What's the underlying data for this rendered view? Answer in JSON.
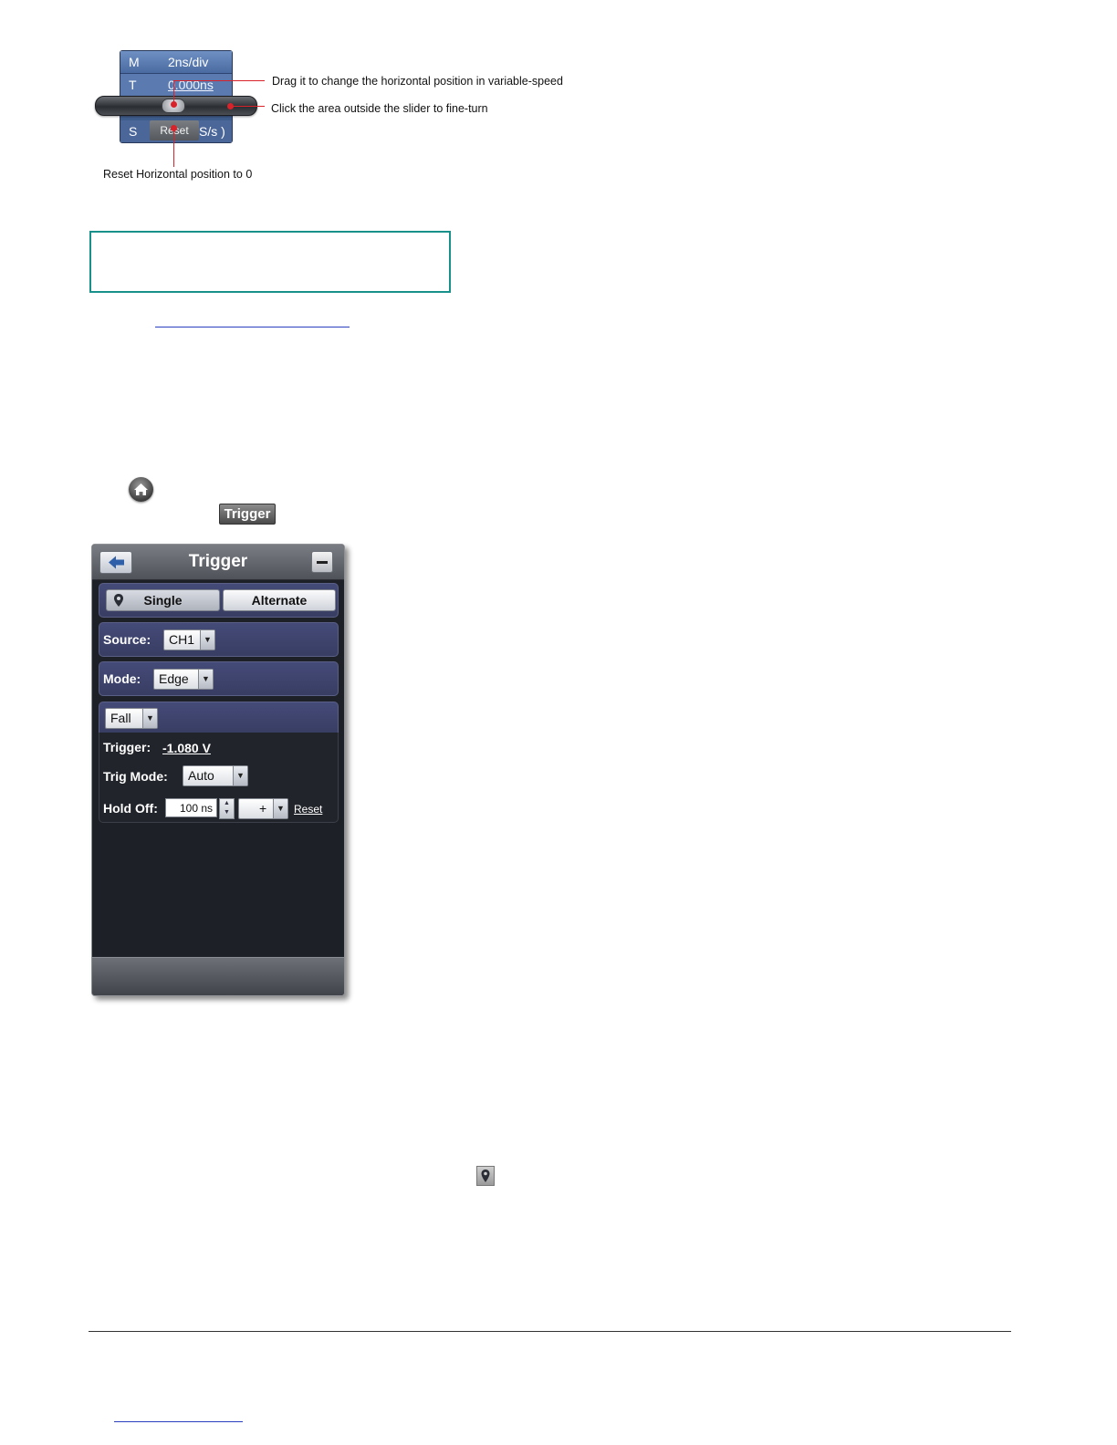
{
  "horizontal_widget": {
    "m_key": "M",
    "m_value": "2ns/div",
    "t_key": "T",
    "t_value": "0.000ns",
    "s_key": "S",
    "s_value": "S/s )",
    "reset_label": "Reset"
  },
  "annotations": {
    "drag": "Drag it to change the horizontal position in variable-speed",
    "click": "Click the area outside the slider to fine-turn",
    "reset": "Reset Horizontal position to 0"
  },
  "trigger_chip_label": "Trigger",
  "dialog": {
    "title": "Trigger",
    "single_label": "Single",
    "alternate_label": "Alternate",
    "source_label": "Source:",
    "source_value": "CH1",
    "mode_label": "Mode:",
    "mode_value": "Edge",
    "slope_value": "Fall",
    "trigger_label": "Trigger:",
    "trigger_value": "-1.080 V",
    "trig_mode_label": "Trig Mode:",
    "trig_mode_value": "Auto",
    "hold_off_label": "Hold Off:",
    "hold_off_value": "100 ns",
    "hold_off_step": "+",
    "reset_link": "Reset"
  },
  "colors": {
    "callout": "#d8232a",
    "note_border": "#17918a",
    "link": "#2a3fbf",
    "dialog_section": "#454b78"
  },
  "icons": {
    "home": "home-icon",
    "back": "arrow-left-icon",
    "minimize": "minus-icon",
    "pin": "location-pin-icon"
  }
}
